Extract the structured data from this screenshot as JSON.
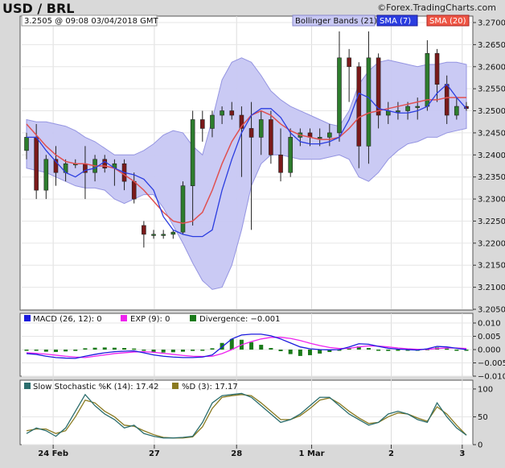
{
  "header": {
    "pair": "USD / BRL",
    "brand": "©Forex.TradingCharts.com",
    "quote": "3.2505 @ 09:08  03/04/2018 GMT"
  },
  "legend": {
    "bollinger": "Bollinger Bands (21)",
    "sma7": "SMA (7)",
    "sma20": "SMA (20)"
  },
  "colors": {
    "band_fill": "#c8c8f4",
    "sma7": "#2b3de0",
    "sma20": "#e05050",
    "up_candle": "#2d7d2d",
    "down_candle": "#7a1a1a",
    "macd": "#1a1add",
    "exp": "#ee22ee",
    "divergence": "#1a7a1a",
    "stoch_k": "#2b6d6d",
    "stoch_d": "#8a7a20"
  },
  "macd_legend": {
    "macd": "MACD (26, 12): 0",
    "exp": "EXP (9): 0",
    "divergence": "Divergence: −0.001"
  },
  "stoch_legend": {
    "k": "Slow Stochastic %K (14): 17.42",
    "d": "%D (3): 17.17"
  },
  "chart_data": [
    {
      "type": "candlestick",
      "title": "USD / BRL",
      "ylim": [
        3.205,
        3.27
      ],
      "y_ticks": [
        "3.2700",
        "3.2650",
        "3.2600",
        "3.2550",
        "3.2500",
        "3.2450",
        "3.2400",
        "3.2350",
        "3.2300",
        "3.2250",
        "3.2200",
        "3.2150",
        "3.2100",
        "3.2050"
      ],
      "x_ticks": [
        {
          "label": "24 Feb",
          "t": 0.07
        },
        {
          "label": "27",
          "t": 0.295
        },
        {
          "label": "28",
          "t": 0.478
        },
        {
          "label": "1 Mar",
          "t": 0.645
        },
        {
          "label": "2",
          "t": 0.822
        },
        {
          "label": "3",
          "t": 0.98
        }
      ],
      "series": [
        {
          "name": "Bollinger Bands (21)",
          "upper": [
            3.248,
            3.2475,
            3.2475,
            3.247,
            3.2465,
            3.2455,
            3.244,
            3.243,
            3.2415,
            3.24,
            3.24,
            3.24,
            3.241,
            3.2425,
            3.2445,
            3.2455,
            3.245,
            3.242,
            3.24,
            3.248,
            3.257,
            3.261,
            3.262,
            3.261,
            3.258,
            3.2545,
            3.2525,
            3.251,
            3.25,
            3.249,
            3.248,
            3.247,
            3.2465,
            3.25,
            3.256,
            3.259,
            3.261,
            3.2615,
            3.261,
            3.2605,
            3.26,
            3.2605,
            3.2605,
            3.261,
            3.261,
            3.2605
          ],
          "lower": [
            3.237,
            3.2365,
            3.236,
            3.235,
            3.234,
            3.233,
            3.2325,
            3.2325,
            3.232,
            3.23,
            3.229,
            3.23,
            3.231,
            3.231,
            3.228,
            3.224,
            3.22,
            3.2155,
            3.2115,
            3.2095,
            3.21,
            3.215,
            3.223,
            3.233,
            3.238,
            3.24,
            3.24,
            3.2395,
            3.239,
            3.239,
            3.239,
            3.2395,
            3.24,
            3.239,
            3.235,
            3.234,
            3.236,
            3.239,
            3.241,
            3.2425,
            3.243,
            3.244,
            3.244,
            3.245,
            3.2455,
            3.246
          ]
        },
        {
          "name": "SMA (7)",
          "values": [
            3.244,
            3.244,
            3.241,
            3.2385,
            3.236,
            3.235,
            3.2365,
            3.237,
            3.2385,
            3.237,
            3.236,
            3.2355,
            3.2345,
            3.232,
            3.226,
            3.223,
            3.222,
            3.2215,
            3.2215,
            3.223,
            3.232,
            3.239,
            3.245,
            3.249,
            3.2505,
            3.2505,
            3.2485,
            3.245,
            3.243,
            3.2425,
            3.2425,
            3.243,
            3.244,
            3.248,
            3.254,
            3.253,
            3.2505,
            3.25,
            3.2495,
            3.2495,
            3.25,
            3.251,
            3.254,
            3.256,
            3.253,
            3.2505
          ]
        },
        {
          "name": "SMA (20)",
          "values": [
            3.247,
            3.2445,
            3.242,
            3.24,
            3.2385,
            3.238,
            3.238,
            3.2375,
            3.2375,
            3.237,
            3.2355,
            3.234,
            3.232,
            3.2295,
            3.227,
            3.225,
            3.2245,
            3.225,
            3.227,
            3.232,
            3.238,
            3.243,
            3.2465,
            3.249,
            3.25,
            3.249,
            3.247,
            3.2455,
            3.2445,
            3.244,
            3.2435,
            3.2435,
            3.244,
            3.246,
            3.2485,
            3.2495,
            3.25,
            3.2505,
            3.251,
            3.2515,
            3.252,
            3.2525,
            3.2525,
            3.253,
            3.253,
            3.253
          ]
        },
        {
          "name": "candles",
          "ohlc": [
            [
              3.241,
              3.245,
              3.239,
              3.244
            ],
            [
              3.244,
              3.247,
              3.23,
              3.232
            ],
            [
              3.232,
              3.24,
              3.23,
              3.239
            ],
            [
              3.239,
              3.242,
              3.233,
              3.236
            ],
            [
              3.236,
              3.239,
              3.234,
              3.238
            ],
            [
              3.238,
              3.239,
              3.237,
              3.238
            ],
            [
              3.238,
              3.242,
              3.23,
              3.236
            ],
            [
              3.236,
              3.24,
              3.234,
              3.239
            ],
            [
              3.239,
              3.24,
              3.236,
              3.237
            ],
            [
              3.237,
              3.239,
              3.233,
              3.238
            ],
            [
              3.238,
              3.239,
              3.232,
              3.234
            ],
            [
              3.234,
              3.236,
              3.229,
              3.23
            ],
            [
              3.224,
              3.225,
              3.219,
              3.222
            ],
            [
              3.222,
              3.223,
              3.221,
              3.222
            ],
            [
              3.222,
              3.223,
              3.221,
              3.222
            ],
            [
              3.222,
              3.223,
              3.221,
              3.2225
            ],
            [
              3.2225,
              3.234,
              3.222,
              3.233
            ],
            [
              3.233,
              3.25,
              3.224,
              3.248
            ],
            [
              3.248,
              3.25,
              3.243,
              3.246
            ],
            [
              3.246,
              3.25,
              3.244,
              3.249
            ],
            [
              3.249,
              3.251,
              3.247,
              3.25
            ],
            [
              3.25,
              3.252,
              3.248,
              3.249
            ],
            [
              3.249,
              3.251,
              3.235,
              3.246
            ],
            [
              3.246,
              3.252,
              3.223,
              3.244
            ],
            [
              3.244,
              3.25,
              3.24,
              3.248
            ],
            [
              3.248,
              3.25,
              3.238,
              3.24
            ],
            [
              3.24,
              3.246,
              3.234,
              3.236
            ],
            [
              3.236,
              3.246,
              3.235,
              3.244
            ],
            [
              3.244,
              3.246,
              3.242,
              3.245
            ],
            [
              3.245,
              3.246,
              3.242,
              3.244
            ],
            [
              3.244,
              3.246,
              3.242,
              3.244
            ],
            [
              3.244,
              3.247,
              3.242,
              3.245
            ],
            [
              3.245,
              3.268,
              3.243,
              3.262
            ],
            [
              3.262,
              3.264,
              3.252,
              3.26
            ],
            [
              3.26,
              3.261,
              3.237,
              3.242
            ],
            [
              3.242,
              3.268,
              3.238,
              3.262
            ],
            [
              3.262,
              3.263,
              3.246,
              3.249
            ],
            [
              3.249,
              3.252,
              3.247,
              3.25
            ],
            [
              3.25,
              3.252,
              3.248,
              3.25
            ],
            [
              3.25,
              3.252,
              3.248,
              3.251
            ],
            [
              3.251,
              3.253,
              3.248,
              3.251
            ],
            [
              3.251,
              3.266,
              3.25,
              3.263
            ],
            [
              3.263,
              3.264,
              3.252,
              3.256
            ],
            [
              3.256,
              3.258,
              3.247,
              3.249
            ],
            [
              3.249,
              3.253,
              3.248,
              3.251
            ],
            [
              3.251,
              3.252,
              3.25,
              3.2505
            ]
          ]
        }
      ]
    },
    {
      "type": "line",
      "title": "MACD",
      "ylim": [
        -0.01,
        0.01
      ],
      "y_ticks": [
        "0.010",
        "0.005",
        "0.000",
        "−0.005",
        "−0.010"
      ],
      "series": [
        {
          "name": "MACD (26, 12)",
          "values": [
            -0.0015,
            -0.0018,
            -0.0025,
            -0.003,
            -0.0032,
            -0.0033,
            -0.0025,
            -0.0018,
            -0.0012,
            -0.0008,
            -0.0006,
            -0.0005,
            -0.0012,
            -0.002,
            -0.0025,
            -0.0028,
            -0.003,
            -0.003,
            -0.0028,
            -0.002,
            0.001,
            0.004,
            0.0055,
            0.0058,
            0.0058,
            0.0052,
            0.004,
            0.0025,
            0.001,
            0.0003,
            0.0,
            -0.0001,
            0.0,
            0.001,
            0.0022,
            0.002,
            0.0012,
            0.0005,
            0.0002,
            0.0,
            -0.0002,
            0.0003,
            0.0012,
            0.001,
            0.0005,
            0.0
          ]
        },
        {
          "name": "EXP (9)",
          "values": [
            -0.0012,
            -0.0014,
            -0.0017,
            -0.0021,
            -0.0025,
            -0.0028,
            -0.003,
            -0.0025,
            -0.002,
            -0.0015,
            -0.0012,
            -0.0009,
            -0.0008,
            -0.001,
            -0.0014,
            -0.0018,
            -0.0022,
            -0.0025,
            -0.0026,
            -0.0025,
            -0.0015,
            0.0,
            0.0018,
            0.003,
            0.004,
            0.0046,
            0.0046,
            0.0042,
            0.0034,
            0.0024,
            0.0015,
            0.0008,
            0.0004,
            0.0005,
            0.001,
            0.0014,
            0.0013,
            0.001,
            0.0006,
            0.0003,
            0.0001,
            0.0001,
            0.0004,
            0.0006,
            0.0006,
            0.0004
          ]
        },
        {
          "name": "Divergence",
          "values": [
            -0.0003,
            -0.0004,
            -0.0008,
            -0.0009,
            -0.0007,
            -0.0005,
            0.0005,
            0.0007,
            0.0008,
            0.0007,
            0.0006,
            0.0004,
            -0.0004,
            -0.001,
            -0.0011,
            -0.001,
            -0.0008,
            -0.0005,
            -0.0002,
            0.0005,
            0.0025,
            0.004,
            0.0037,
            0.0028,
            0.0018,
            0.0006,
            -0.0006,
            -0.0017,
            -0.0024,
            -0.0021,
            -0.0015,
            -0.0009,
            -0.0004,
            0.0005,
            0.0012,
            0.0006,
            -0.0001,
            -0.0005,
            -0.0004,
            -0.0003,
            -0.0003,
            0.0002,
            0.0008,
            0.0004,
            -0.0001,
            -0.0004
          ]
        }
      ]
    },
    {
      "type": "line",
      "title": "Slow Stochastic",
      "ylim": [
        0,
        110
      ],
      "y_ticks": [
        "100",
        "50",
        "0"
      ],
      "series": [
        {
          "name": "Slow Stochastic %K (14)",
          "values": [
            20,
            30,
            25,
            15,
            30,
            60,
            90,
            70,
            55,
            45,
            30,
            35,
            20,
            15,
            12,
            12,
            13,
            15,
            40,
            75,
            88,
            90,
            92,
            85,
            70,
            55,
            40,
            45,
            55,
            70,
            85,
            85,
            70,
            55,
            45,
            35,
            40,
            55,
            60,
            55,
            45,
            40,
            75,
            50,
            30,
            17
          ]
        },
        {
          "name": "%D (3)",
          "values": [
            25,
            28,
            28,
            20,
            25,
            50,
            80,
            75,
            60,
            50,
            35,
            33,
            25,
            18,
            13,
            12,
            12,
            14,
            32,
            65,
            85,
            88,
            90,
            88,
            75,
            60,
            45,
            45,
            52,
            65,
            80,
            84,
            74,
            60,
            48,
            38,
            40,
            50,
            57,
            55,
            48,
            42,
            68,
            55,
            35,
            17
          ]
        }
      ]
    }
  ]
}
